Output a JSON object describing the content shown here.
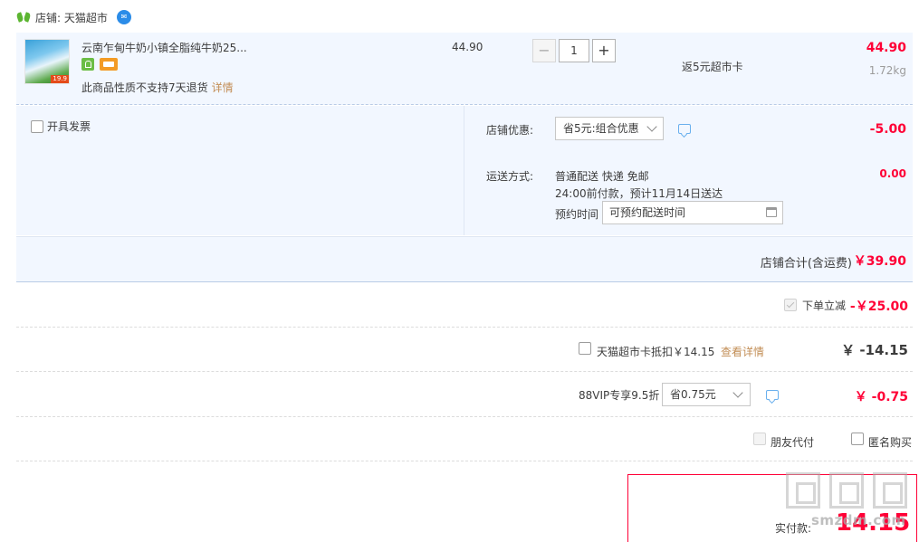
{
  "store": {
    "label": "店铺: 天猫超市"
  },
  "item": {
    "title": "云南乍甸牛奶小镇全脂纯牛奶25...",
    "thumb_tag": "19.9",
    "note": "此商品性质不支持7天退货",
    "note_link": "详情",
    "unit_price": "44.90",
    "qty_minus": "−",
    "qty_value": "1",
    "qty_plus": "+",
    "rebate": "返5元超市卡",
    "total": "44.90",
    "weight": "1.72kg"
  },
  "options": {
    "invoice_label": "开具发票",
    "discount_label": "店铺优惠:",
    "discount_value": "省5元:组合优惠",
    "discount_amount": "-5.00",
    "shipping_label": "运送方式:",
    "shipping_line1": "普通配送 快递 免邮",
    "shipping_line2": "24:00前付款，预计11月14日送达",
    "shipping_amount": "0.00",
    "reserve_label": "预约时间",
    "reserve_placeholder": "可预约配送时间"
  },
  "store_total": {
    "label": "店铺合计(含运费)",
    "amount": "￥39.90"
  },
  "instant_discount": {
    "label": "下单立减",
    "amount": "-￥25.00"
  },
  "supermarket_card": {
    "label": "天猫超市卡抵扣￥14.15",
    "link": "查看详情",
    "amount": "￥ -14.15"
  },
  "vip": {
    "label": "88VIP专享9.5折",
    "select_value": "省0.75元",
    "amount": "￥ -0.75"
  },
  "extras": {
    "friend_pay_label": "朋友代付",
    "anonymous_label": "匿名购买"
  },
  "pay": {
    "label": "实付款:",
    "amount": "14.15"
  },
  "watermark": {
    "text": "smzdm.com"
  },
  "colors": {
    "accent_red": "#ff0036",
    "row_bg": "#f2f7ff",
    "link_brown": "#c28d55"
  }
}
